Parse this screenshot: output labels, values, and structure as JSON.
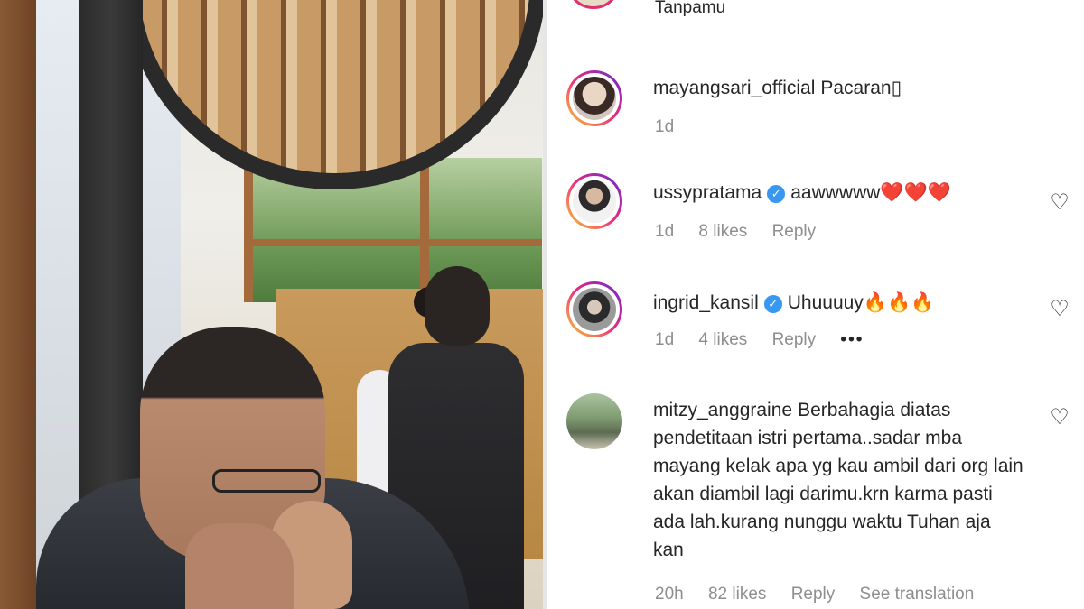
{
  "previous_comment": {
    "text": "Tanpamu"
  },
  "comments": [
    {
      "username": "mayangsari_official",
      "verified": false,
      "text": "Pacaran",
      "text_suffix": "▯",
      "time": "1d",
      "likes": "",
      "reply": "",
      "show_heart": false
    },
    {
      "username": "ussypratama",
      "verified": true,
      "text": "aawwwww",
      "emoji": "❤️❤️❤️",
      "time": "1d",
      "likes": "8 likes",
      "reply": "Reply",
      "show_heart": true
    },
    {
      "username": "ingrid_kansil",
      "verified": true,
      "text": "Uhuuuuy",
      "emoji": "🔥🔥🔥",
      "time": "1d",
      "likes": "4 likes",
      "reply": "Reply",
      "more": "•••",
      "show_heart": true
    },
    {
      "username": "mitzy_anggraine",
      "verified": false,
      "text": "Berbahagia diatas pendetitaan istri pertama..sadar mba mayang kelak apa yg kau ambil dari org lain akan diambil lagi darimu.krn karma pasti ada lah.kurang nunggu waktu Tuhan aja kan",
      "time": "20h",
      "likes": "82 likes",
      "reply": "Reply",
      "translate": "See translation",
      "show_heart": true
    }
  ],
  "icons": {
    "like": "heart-outline-icon",
    "verified": "verified-badge-icon",
    "more": "more-options-icon"
  },
  "colors": {
    "verified": "#3897f0",
    "meta_text": "#8e8e8e",
    "story_ring": [
      "#f9ce34",
      "#ee2a7b",
      "#6228d7"
    ]
  }
}
